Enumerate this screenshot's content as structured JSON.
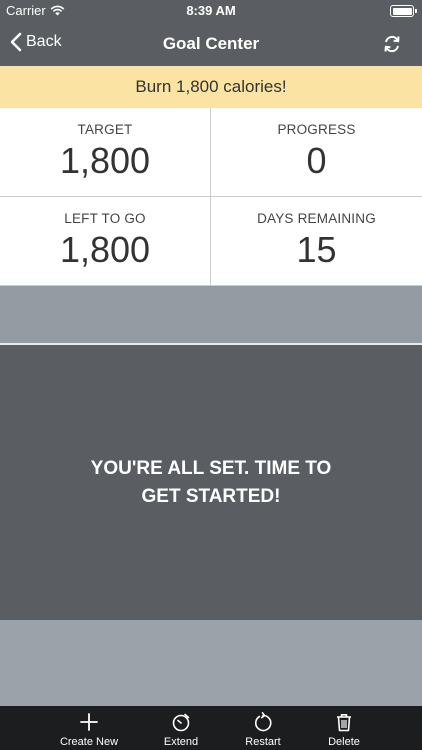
{
  "status_bar": {
    "carrier": "Carrier",
    "time": "8:39 AM"
  },
  "nav": {
    "back_label": "Back",
    "title": "Goal Center"
  },
  "banner": {
    "text": "Burn 1,800 calories!"
  },
  "stats": {
    "target": {
      "label": "TARGET",
      "value": "1,800"
    },
    "progress": {
      "label": "PROGRESS",
      "value": "0"
    },
    "left_to_go": {
      "label": "LEFT TO GO",
      "value": "1,800"
    },
    "days_remaining": {
      "label": "DAYS REMAINING",
      "value": "15"
    }
  },
  "panel": {
    "message": "YOU'RE ALL SET. TIME TO GET STARTED!"
  },
  "tabs": [
    {
      "label": "Create New",
      "icon": "plus-icon"
    },
    {
      "label": "Extend",
      "icon": "timer-icon"
    },
    {
      "label": "Restart",
      "icon": "restart-icon"
    },
    {
      "label": "Delete",
      "icon": "trash-icon"
    }
  ]
}
